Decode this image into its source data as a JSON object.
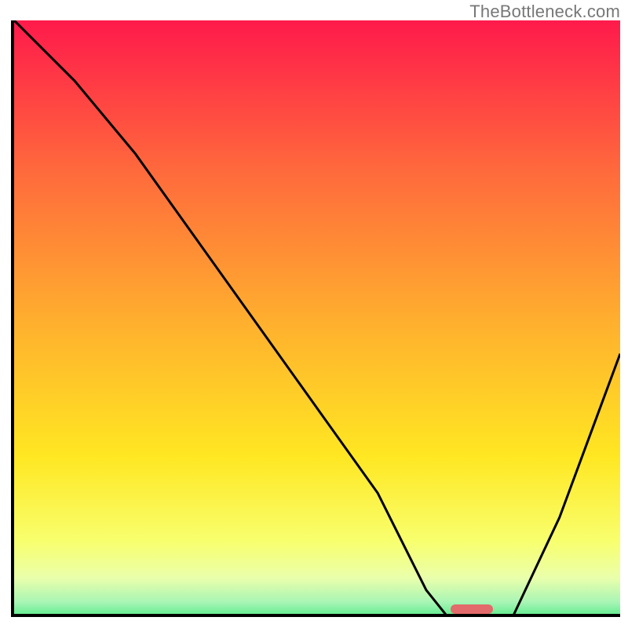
{
  "watermark": "TheBottleneck.com",
  "colors": {
    "axis": "#000000",
    "curve": "#000000",
    "marker": "#e36a6a",
    "gradient_stops": [
      {
        "offset": 0.0,
        "color": "#ff1a4b"
      },
      {
        "offset": 0.25,
        "color": "#ff6a3c"
      },
      {
        "offset": 0.5,
        "color": "#ffb02e"
      },
      {
        "offset": 0.72,
        "color": "#ffe722"
      },
      {
        "offset": 0.86,
        "color": "#f8ff6e"
      },
      {
        "offset": 0.92,
        "color": "#eaffab"
      },
      {
        "offset": 0.96,
        "color": "#a8f5b5"
      },
      {
        "offset": 1.0,
        "color": "#27e46f"
      }
    ]
  },
  "chart_data": {
    "type": "line",
    "title": "",
    "xlabel": "",
    "ylabel": "",
    "xlim": [
      0,
      100
    ],
    "ylim": [
      0,
      100
    ],
    "x": [
      0,
      10,
      20,
      30,
      40,
      50,
      60,
      68,
      72,
      76,
      82,
      90,
      100
    ],
    "y": [
      100,
      90,
      78,
      64,
      50,
      36,
      22,
      6,
      1,
      0,
      1,
      18,
      45
    ],
    "marker": {
      "x_start": 72,
      "x_end": 79,
      "y": 0
    },
    "note": "x and y are percent of plot width/height; y=0 is bottom. Curve: steep descent with slope change near x≈20, minimum plateau around x≈72–78, then rises to ~45 at x=100."
  }
}
